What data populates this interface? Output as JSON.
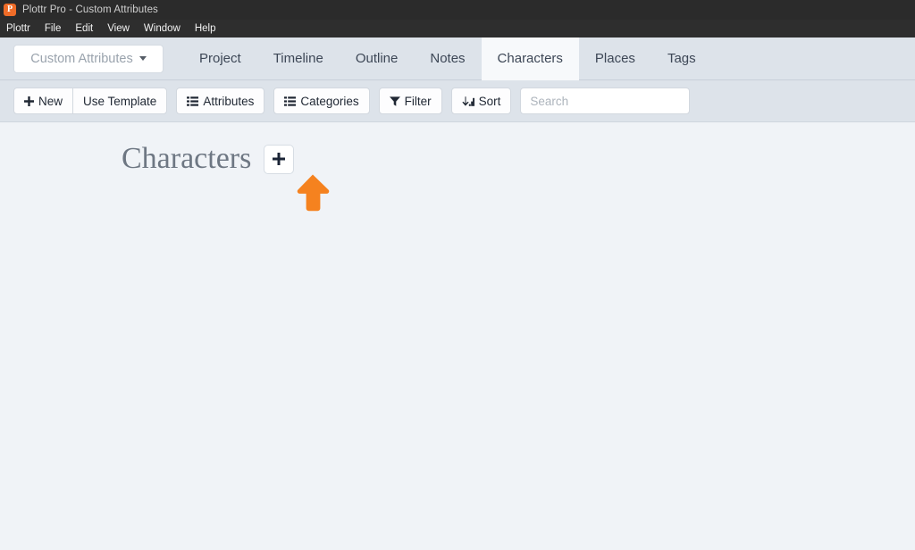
{
  "window": {
    "title": "Plottr Pro - Custom Attributes",
    "app_icon": "plottr-app-icon",
    "icon_letter": "P"
  },
  "menubar": {
    "items": [
      {
        "label": "Plottr"
      },
      {
        "label": "File"
      },
      {
        "label": "Edit"
      },
      {
        "label": "View"
      },
      {
        "label": "Window"
      },
      {
        "label": "Help"
      }
    ]
  },
  "tabbar": {
    "dropdown": {
      "label": "Custom Attributes",
      "icon": "chevron-down-icon"
    },
    "tabs": [
      {
        "label": "Project",
        "active": false
      },
      {
        "label": "Timeline",
        "active": false
      },
      {
        "label": "Outline",
        "active": false
      },
      {
        "label": "Notes",
        "active": false
      },
      {
        "label": "Characters",
        "active": true
      },
      {
        "label": "Places",
        "active": false
      },
      {
        "label": "Tags",
        "active": false
      }
    ]
  },
  "toolbar": {
    "new_label": "New",
    "new_icon": "plus-icon",
    "use_template_label": "Use Template",
    "attributes_label": "Attributes",
    "attributes_icon": "list-icon",
    "categories_label": "Categories",
    "categories_icon": "list-icon",
    "filter_label": "Filter",
    "filter_icon": "funnel-icon",
    "sort_label": "Sort",
    "sort_icon": "sort-amount-icon",
    "search_placeholder": "Search",
    "search_value": ""
  },
  "main": {
    "heading": "Characters",
    "add_button_icon": "plus-icon",
    "annotation_icon": "orange-up-arrow"
  },
  "colors": {
    "accent_orange": "#f5821f",
    "chrome_blue_grey": "#dde3ea",
    "content_background": "#f0f3f7",
    "menubar_dark": "#2e2e2e",
    "heading_grey": "#6e7783"
  }
}
